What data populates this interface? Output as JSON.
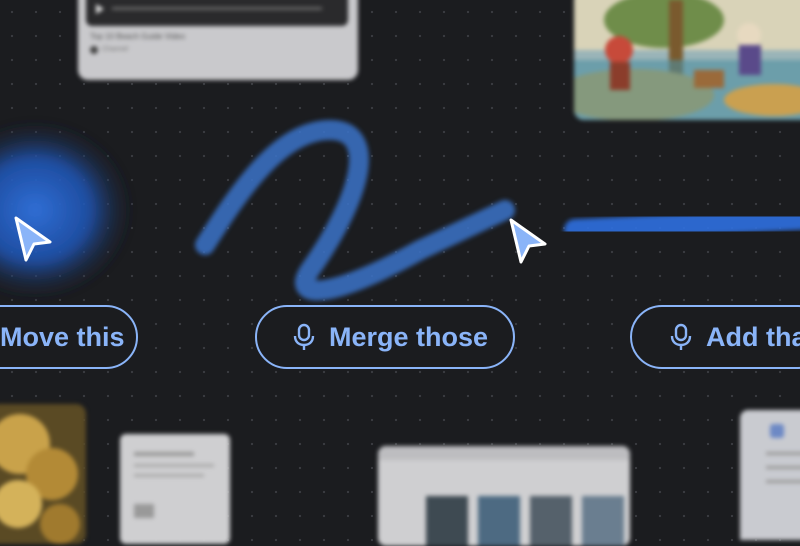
{
  "colors": {
    "background": "#1b1c1f",
    "accent": "#8ab4f8",
    "stroke": "#4285f4",
    "cursor_fill": "#8ab4f8"
  },
  "commands": [
    {
      "label": "Move this",
      "icon": "microphone-icon"
    },
    {
      "label": "Merge those",
      "icon": "microphone-icon"
    },
    {
      "label": "Add tha",
      "icon": "microphone-icon"
    }
  ],
  "cards": {
    "video_card": {
      "title": "Top 10 Beach Guide Video",
      "meta": "Channel"
    }
  }
}
